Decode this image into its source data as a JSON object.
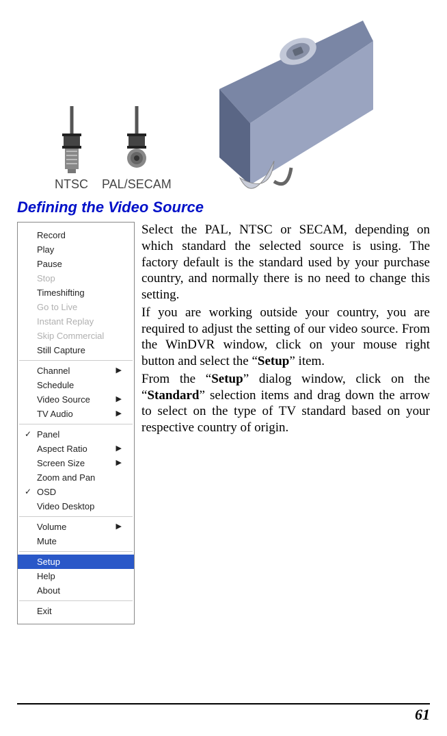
{
  "antenna_labels": {
    "ntsc": "NTSC",
    "palsecam": "PAL/SECAM"
  },
  "section_title": "Defining the Video Source",
  "menu": {
    "group1": [
      {
        "label": "Record"
      },
      {
        "label": "Play"
      },
      {
        "label": "Pause"
      },
      {
        "label": "Stop",
        "disabled": true
      },
      {
        "label": "Timeshifting"
      },
      {
        "label": "Go to Live",
        "disabled": true
      },
      {
        "label": "Instant Replay",
        "disabled": true
      },
      {
        "label": "Skip Commercial",
        "disabled": true
      },
      {
        "label": "Still Capture"
      }
    ],
    "group2": [
      {
        "label": "Channel",
        "submenu": true
      },
      {
        "label": "Schedule"
      },
      {
        "label": "Video Source",
        "submenu": true
      },
      {
        "label": "TV Audio",
        "submenu": true
      }
    ],
    "group3": [
      {
        "label": "Panel",
        "checked": true
      },
      {
        "label": "Aspect Ratio",
        "submenu": true
      },
      {
        "label": "Screen Size",
        "submenu": true
      },
      {
        "label": "Zoom and Pan"
      },
      {
        "label": "OSD",
        "checked": true
      },
      {
        "label": "Video Desktop"
      }
    ],
    "group4": [
      {
        "label": "Volume",
        "submenu": true
      },
      {
        "label": "Mute"
      }
    ],
    "group5": [
      {
        "label": "Setup",
        "highlight": true
      },
      {
        "label": "Help"
      },
      {
        "label": "About"
      }
    ],
    "group6": [
      {
        "label": "Exit"
      }
    ]
  },
  "body": {
    "p1a": "Select the PAL, NTSC or SECAM, depending on which standard the selected source is using. The factory default is the standard used by your purchase country, and normally there is no need to change this setting.",
    "p2a": "If you are working outside your country, you are required to adjust the setting of our video source. From the WinDVR window, click on your mouse right button and select the “",
    "p2b": "Setup",
    "p2c": "” item.",
    "p3a": "From the “",
    "p3b": "Setup",
    "p3c": "” dialog window, click on the “",
    "p3d": "Standard",
    "p3e": "” selection items and drag down the arrow to select on the type of TV standard based on your respective country of origin."
  },
  "page_number": "61"
}
